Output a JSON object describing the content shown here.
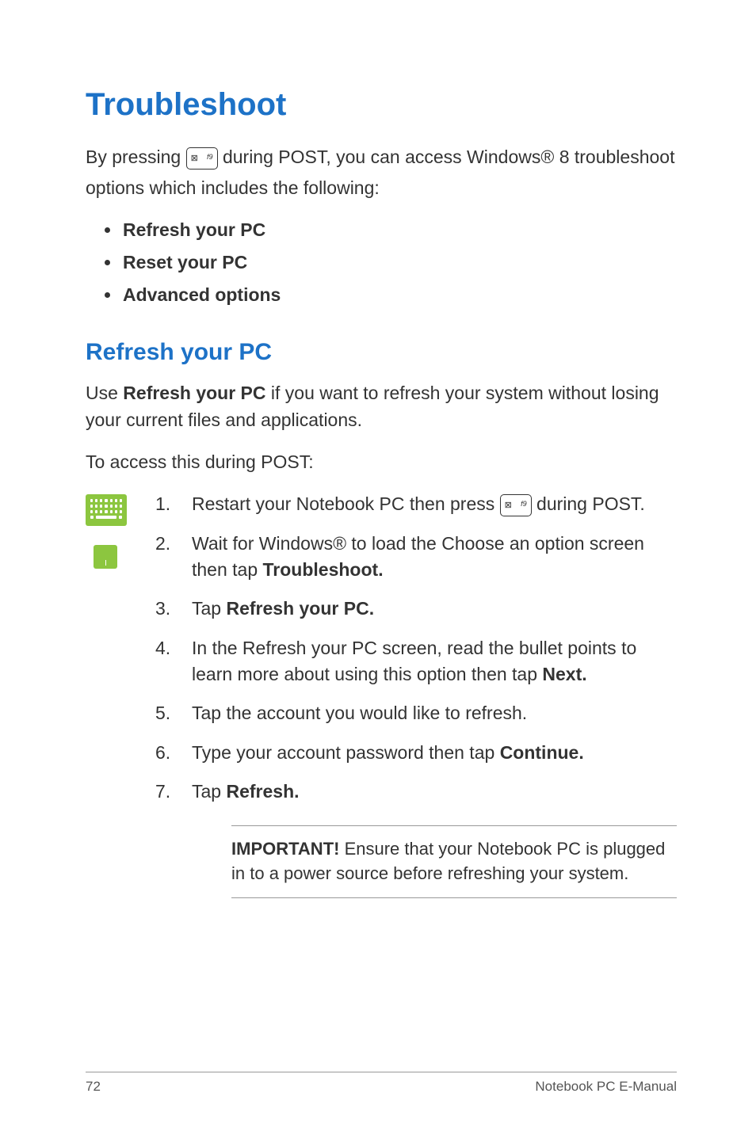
{
  "title": "Troubleshoot",
  "intro_1": "By pressing ",
  "intro_2": " during POST, you can access Windows® 8 troubleshoot options which includes the following:",
  "key_label": "f9",
  "bullets": [
    "Refresh your PC",
    "Reset your PC",
    "Advanced options"
  ],
  "section_title": "Refresh your PC",
  "section_body_1": "Use ",
  "section_body_bold": "Refresh your PC",
  "section_body_2": " if you want to refresh your system without losing your current files and applications.",
  "section_body_3": "To access this during POST:",
  "steps": {
    "s1_a": "Restart your Notebook PC then press ",
    "s1_b": " during POST.",
    "s2_a": "Wait for Windows® to load the Choose an option screen then tap ",
    "s2_b": "Troubleshoot.",
    "s3_a": "Tap ",
    "s3_b": "Refresh your PC.",
    "s4_a": "In the Refresh your PC screen, read the bullet points to learn more about using this option then tap ",
    "s4_b": "Next.",
    "s5": "Tap the account you would like to refresh.",
    "s6_a": "Type your account password then tap ",
    "s6_b": "Continue.",
    "s7_a": "Tap ",
    "s7_b": "Refresh."
  },
  "important_label": "IMPORTANT!",
  "important_text": " Ensure that your Notebook PC is plugged in to a power source before refreshing your system.",
  "footer_page": "72",
  "footer_label": "Notebook PC E-Manual"
}
